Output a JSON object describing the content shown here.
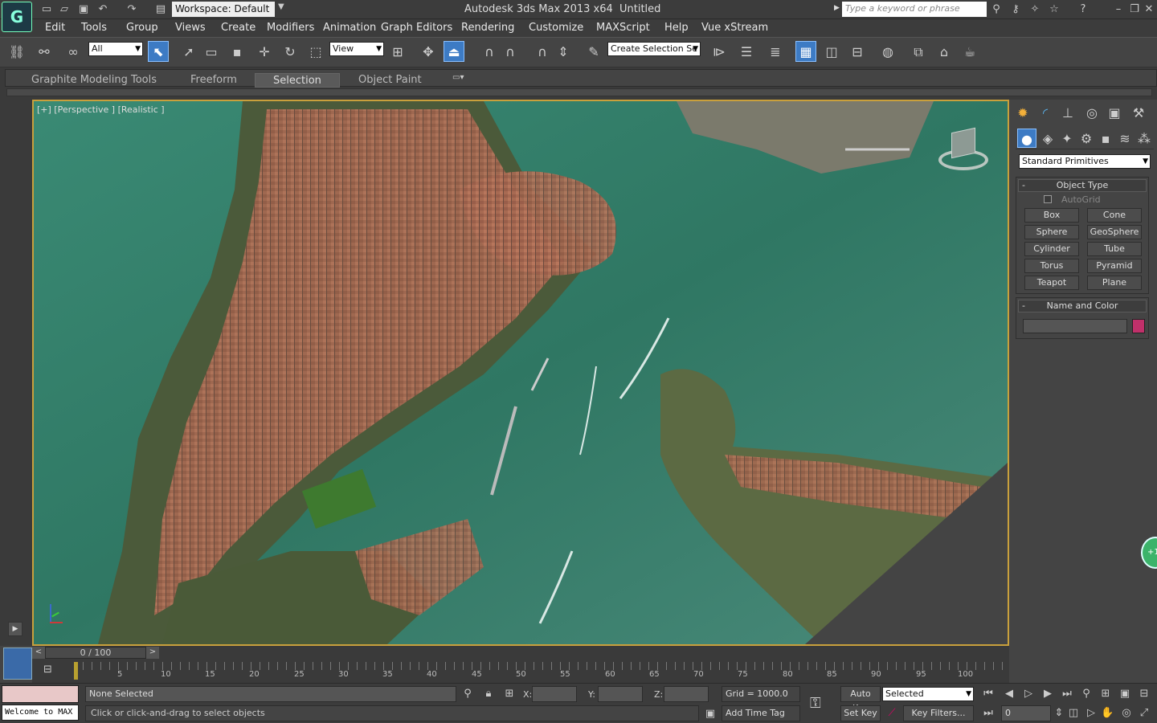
{
  "titlebar": {
    "workspace": "Workspace: Default",
    "app_title": "Autodesk 3ds Max  2013 x64",
    "doc_title": "Untitled",
    "search_placeholder": "Type a keyword or phrase"
  },
  "menu": [
    "Edit",
    "Tools",
    "Group",
    "Views",
    "Create",
    "Modifiers",
    "Animation",
    "Graph Editors",
    "Rendering",
    "Customize",
    "MAXScript",
    "Help",
    "Vue xStream"
  ],
  "toolbar": {
    "filter_value": "All",
    "refcoord_value": "View",
    "selection_set_value": "Create Selection Se"
  },
  "ribbon": {
    "tabs": [
      "Graphite Modeling Tools",
      "Freeform",
      "Selection",
      "Object Paint"
    ],
    "active_tab": "Selection"
  },
  "viewport": {
    "label": "[+] [Perspective ] [Realistic ]"
  },
  "command_panel": {
    "category": "Standard Primitives",
    "object_type_header": "Object Type",
    "autogrid_label": "AutoGrid",
    "primitives": [
      "Box",
      "Cone",
      "Sphere",
      "GeoSphere",
      "Cylinder",
      "Tube",
      "Torus",
      "Pyramid",
      "Teapot",
      "Plane"
    ],
    "name_color_header": "Name and Color",
    "name_value": "",
    "object_color": "#c0306a"
  },
  "timeline": {
    "slider_label": "0 / 100",
    "ticks": [
      "5",
      "10",
      "15",
      "20",
      "25",
      "30",
      "35",
      "40",
      "45",
      "50",
      "55",
      "60",
      "65",
      "70",
      "75",
      "80",
      "85",
      "90",
      "95",
      "100"
    ]
  },
  "status": {
    "listener": "Welcome to MAX",
    "selection_status": "None Selected",
    "prompt": "Click or click-and-drag to select objects",
    "x_label": "X:",
    "y_label": "Y:",
    "z_label": "Z:",
    "grid": "Grid = 1000.0",
    "add_time_tag": "Add Time Tag",
    "auto_key": "Auto Key",
    "set_key": "Set Key",
    "key_mode_value": "Selected",
    "key_filters": "Key Filters...",
    "frame_value": "0"
  },
  "colors": {
    "active_tool": "#3d7bc4",
    "viewport_border": "#c9a03c",
    "water": "#2f6f5e"
  }
}
